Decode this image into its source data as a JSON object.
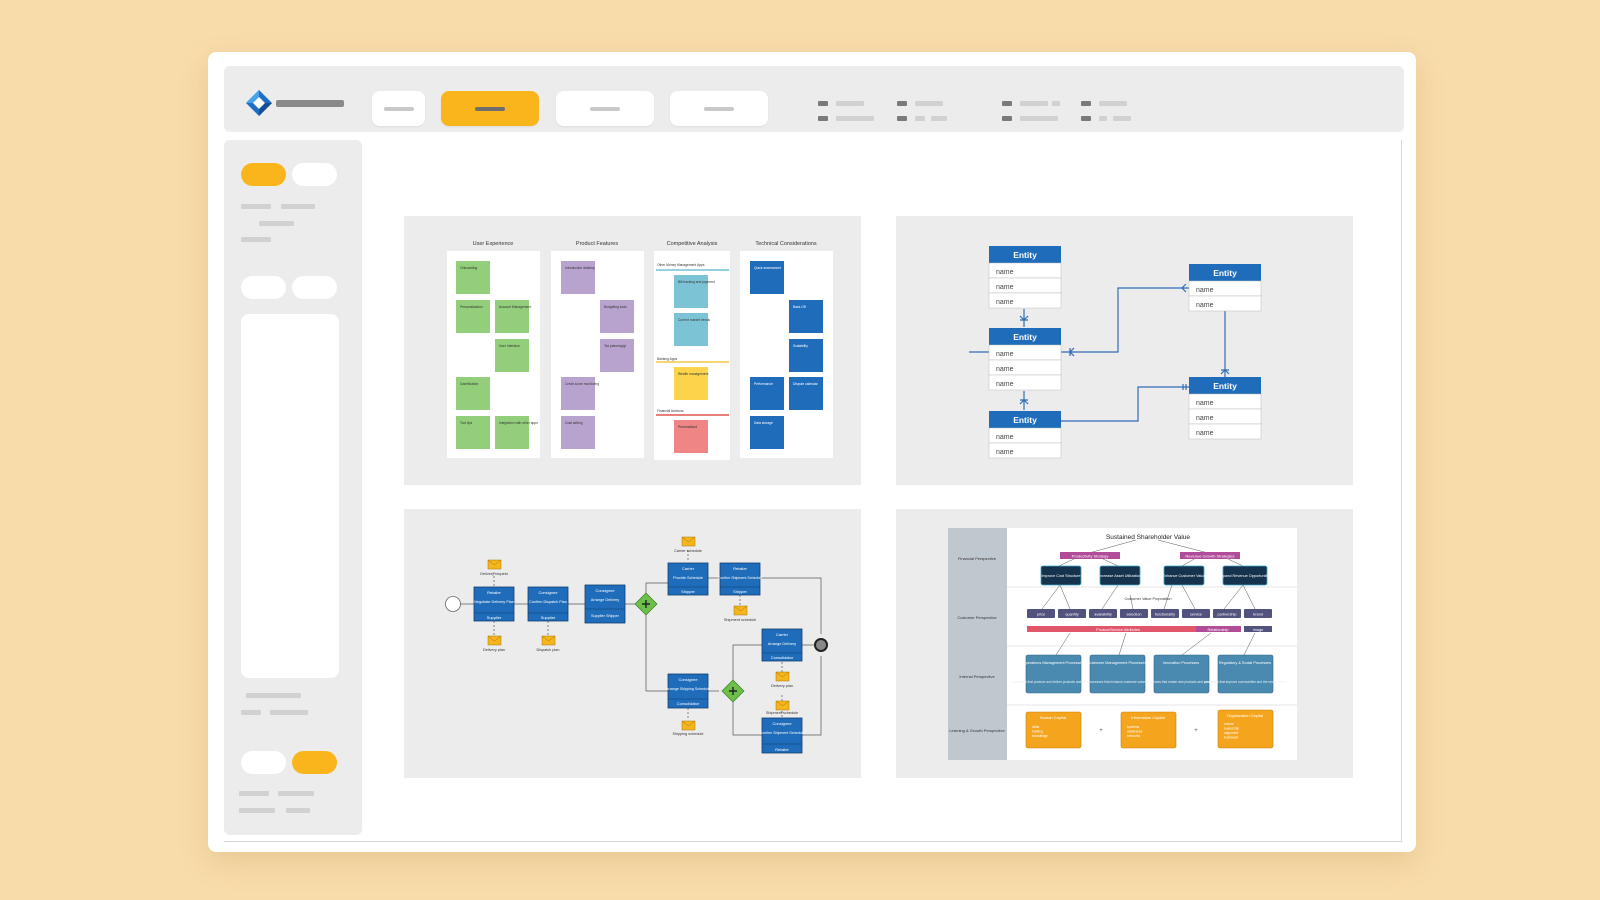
{
  "app": {
    "logo_icon": "diamond-logo-icon",
    "brand_color": "#fbb51c",
    "background": "#f8dcaa"
  },
  "toolbar": {
    "tabs": [
      {
        "active": false
      },
      {
        "active": true
      },
      {
        "active": false
      },
      {
        "active": false
      }
    ]
  },
  "templates": {
    "swimlane": {
      "lanes": [
        "User Experience",
        "Product Features",
        "Competitive Analysis",
        "Technical  Considerations"
      ],
      "notes": {
        "ux": [
          "Onboarding",
          "Personalization",
          "Account Management",
          "User Interface",
          "Gamification",
          "Tool tips",
          "Integration with other apps"
        ],
        "pf": [
          "Introduction desktop",
          "Budgeting tools",
          "Tax planning/gt",
          "Credit score monitoring",
          "Goal setting"
        ],
        "ca": [
          "Other Money Management Apps",
          "Bill tracking and payment",
          "Current market trends",
          "Banking Apps",
          "Wealth management",
          "Financial Advisors",
          "Personalized"
        ],
        "tc": [
          "Quick assessment",
          "Back-Off",
          "Scalability",
          "Performance",
          "Dispute calendar",
          "Data storage"
        ]
      }
    },
    "er": {
      "entity_label": "Entity",
      "attr_label": "name"
    },
    "bpmn": {
      "tasks": [
        {
          "lane": "Retailer",
          "name": "Negotiate Delivery Plan",
          "role": "Supplier"
        },
        {
          "lane": "Consignee",
          "name": "Confirm Dispatch Plan",
          "role": "Supplier"
        },
        {
          "lane": "Consignee",
          "name": "Arrange Delivery",
          "role": "Supplier Shipper"
        },
        {
          "lane": "Carrier",
          "name": "Provide Schedule",
          "role": "Shipper"
        },
        {
          "lane": "Retailer",
          "name": "Confirm Shipment Schedule",
          "role": "Shipper"
        },
        {
          "lane": "Carrier",
          "name": "Arrange Delivery",
          "role": "Consolidator"
        },
        {
          "lane": "Consignee",
          "name": "Arrange Shipping Schedule",
          "role": "Consolidator"
        },
        {
          "lane": "Consignee",
          "name": "Confirm Shipment Schedule",
          "role": "Retailer"
        }
      ],
      "messages": [
        "Delivery request",
        "Delivery plan",
        "Dispatch plan",
        "Carrier schedule",
        "Shipment schedule",
        "Delivery plan",
        "Shipment schedule",
        "Shipping schedule"
      ]
    },
    "strategy": {
      "title": "Sustained Shareholder Value",
      "perspectives": [
        "Financial Perspective",
        "Customer Perspective",
        "Internal Perspective",
        "Learning & Growth Perspective"
      ],
      "strategies": [
        "Productivity Strategy",
        "Revenue Growth Strategies"
      ],
      "objectives": [
        "Improve Cost Structure",
        "Increase Asset Utilization",
        "Enhance Customer Value",
        "Expand Revenue Opportunities"
      ],
      "value_prop": "Customer Value Proposition",
      "attributes": [
        "price",
        "quantity",
        "availability",
        "selection",
        "functionality",
        "service",
        "partnership",
        "brand"
      ],
      "groups": [
        "Product/Service Attributes",
        "Relationship",
        "Image"
      ],
      "processes": [
        {
          "title": "Operations Management Processes",
          "desc": "processes that produce and deliver products and services"
        },
        {
          "title": "Customer Management Processes",
          "desc": "processes that enhance customer value"
        },
        {
          "title": "Innovation Processes",
          "desc": "processes that create new products and services"
        },
        {
          "title": "Regulatory & Social Processes",
          "desc": "processes that improve communities and the environment"
        }
      ],
      "capitals": [
        {
          "title": "Human Capital",
          "items": [
            "skills",
            "training",
            "knowledge"
          ]
        },
        {
          "title": "Information Capital",
          "items": [
            "systems",
            "databases",
            "networks"
          ]
        },
        {
          "title": "Organization Capital",
          "items": [
            "culture",
            "leadership",
            "alignment",
            "teamwork"
          ]
        }
      ],
      "plus": "+"
    }
  }
}
